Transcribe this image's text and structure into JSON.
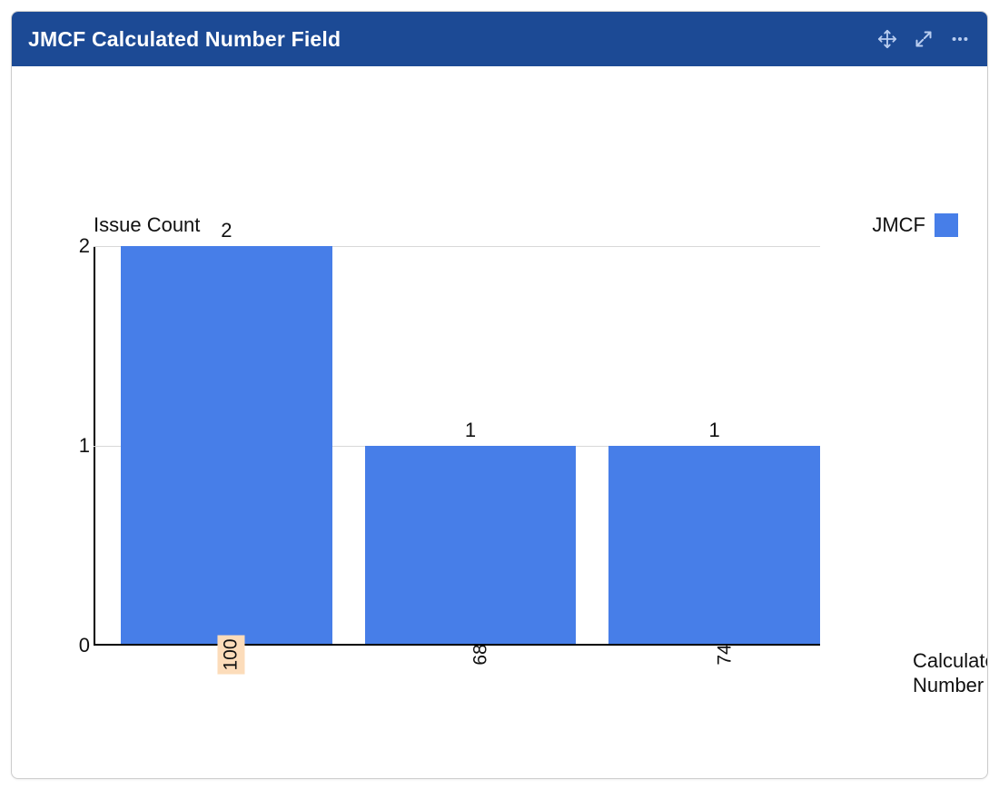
{
  "panel": {
    "title": "JMCF Calculated Number Field"
  },
  "legend": {
    "label": "JMCF"
  },
  "axes": {
    "y_title": "Issue Count",
    "x_title": "Calculated\nNumber"
  },
  "chart_data": {
    "type": "bar",
    "categories": [
      "100",
      "68",
      "74"
    ],
    "values": [
      2,
      1,
      1
    ],
    "series": [
      {
        "name": "JMCF",
        "values": [
          2,
          1,
          1
        ],
        "color": "#477ee8"
      }
    ],
    "highlight_index": 0,
    "data_labels": [
      "2",
      "1",
      "1"
    ],
    "ylabel": "Issue Count",
    "xlabel": "Calculated Number",
    "ylim": [
      0,
      2
    ],
    "y_ticks": [
      0,
      1,
      2
    ],
    "grid": true,
    "legend_position": "top-right",
    "title": "JMCF Calculated Number Field"
  }
}
